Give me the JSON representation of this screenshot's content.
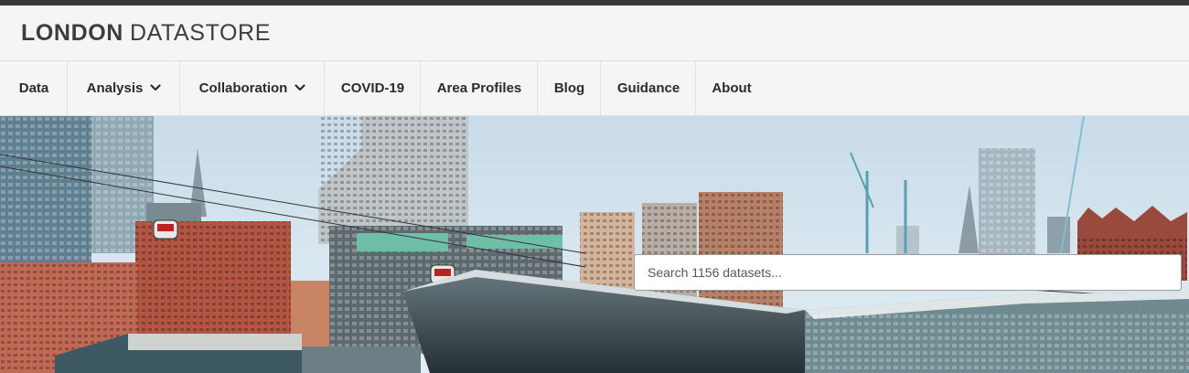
{
  "logo": {
    "bold": "LONDON",
    "light": "DATASTORE"
  },
  "nav": {
    "items": [
      {
        "label": "Data"
      },
      {
        "label": "Analysis",
        "dropdown": true
      },
      {
        "label": "Collaboration",
        "dropdown": true
      },
      {
        "label": "COVID-19"
      },
      {
        "label": "Area Profiles"
      },
      {
        "label": "Blog"
      },
      {
        "label": "Guidance"
      },
      {
        "label": "About"
      }
    ]
  },
  "search": {
    "placeholder": "Search 1156 datasets...",
    "value": ""
  },
  "hero": {
    "image": "london-skyline-cable-car-photo"
  },
  "colors": {
    "topbar": "#3a3a3a",
    "header_bg": "#f5f5f5",
    "text": "#2b2b2b"
  }
}
